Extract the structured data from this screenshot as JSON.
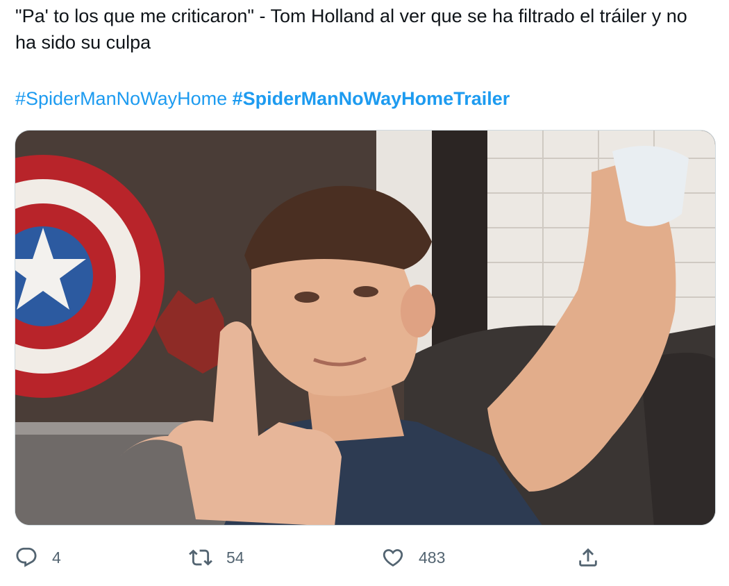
{
  "tweet": {
    "text": "\"Pa' to los que me criticaron\" - Tom Holland al ver que se ha filtrado el tráiler y no ha sido su culpa",
    "hashtags": [
      {
        "text": "#SpiderManNoWayHome",
        "bold": false
      },
      {
        "text": "#SpiderManNoWayHomeTrailer",
        "bold": true
      }
    ]
  },
  "media": {
    "icon": "photo"
  },
  "actions": {
    "reply": {
      "icon": "reply-icon",
      "count": "4"
    },
    "retweet": {
      "icon": "retweet-icon",
      "count": "54"
    },
    "like": {
      "icon": "heart-icon",
      "count": "483"
    },
    "share": {
      "icon": "share-icon"
    }
  },
  "colors": {
    "text": "#0f1419",
    "link": "#1d9bf0",
    "muted": "#536471",
    "border": "#cfd9de"
  }
}
